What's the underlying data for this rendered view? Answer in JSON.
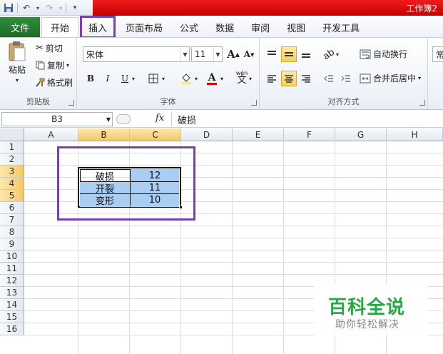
{
  "window": {
    "title": "工作簿2"
  },
  "qat": {
    "save": "save-icon",
    "undo": "undo-icon",
    "redo": "redo-icon",
    "customize": "customize-icon"
  },
  "tabs": [
    {
      "label": "文件"
    },
    {
      "label": "开始"
    },
    {
      "label": "插入"
    },
    {
      "label": "页面布局"
    },
    {
      "label": "公式"
    },
    {
      "label": "数据"
    },
    {
      "label": "审阅"
    },
    {
      "label": "视图"
    },
    {
      "label": "开发工具"
    }
  ],
  "ribbon": {
    "clipboard": {
      "label": "剪贴板",
      "paste": "粘贴",
      "cut": "剪切",
      "copy": "复制",
      "format_painter": "格式刷"
    },
    "font": {
      "label": "字体",
      "font_name": "宋体",
      "font_size": "11",
      "bold": "B",
      "italic": "I",
      "underline": "U",
      "grow": "A",
      "shrink": "A",
      "wen": "wén",
      "wen_char": "文"
    },
    "alignment": {
      "label": "对齐方式",
      "wrap": "自动换行",
      "merge": "合并后居中"
    },
    "number": {
      "partial": "常"
    }
  },
  "formula_bar": {
    "name_box": "B3",
    "fx": "fx",
    "content": "破损"
  },
  "columns": [
    "A",
    "B",
    "C",
    "D",
    "E",
    "F",
    "G",
    "H"
  ],
  "rows": [
    "1",
    "2",
    "3",
    "4",
    "5",
    "6",
    "7",
    "8",
    "9",
    "10",
    "11",
    "12",
    "13",
    "14",
    "15",
    "16"
  ],
  "table": [
    {
      "b": "破损",
      "c": "12"
    },
    {
      "b": "开裂",
      "c": "11"
    },
    {
      "b": "变形",
      "c": "10"
    }
  ],
  "watermark": {
    "title": "百科全说",
    "subtitle": "助你轻松解决"
  },
  "colors": {
    "accent_purple": "#7a3fb0",
    "selection_blue": "#a9cdf3",
    "file_tab": "#1c6c27",
    "title_red": "#c20000"
  }
}
